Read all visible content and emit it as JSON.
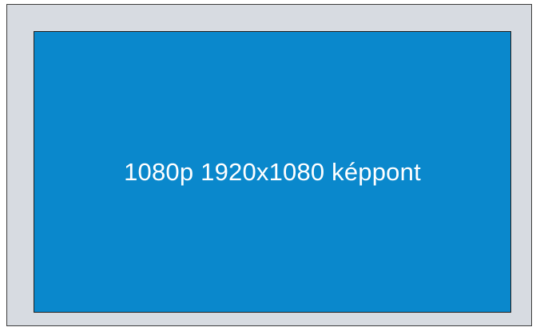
{
  "diagram": {
    "label": "1080p 1920x1080 képpont"
  },
  "colors": {
    "outer_frame": "#d7dbe1",
    "screen": "#0a88cc",
    "text": "#ffffff",
    "border": "#1f1f1f"
  }
}
